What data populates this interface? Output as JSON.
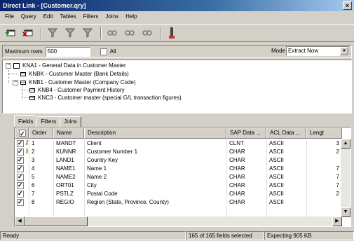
{
  "window": {
    "title": "Direct Link - [Customer.qry]",
    "close_glyph": "×"
  },
  "menu": [
    {
      "key": "F",
      "rest": "ile"
    },
    {
      "key": "Q",
      "rest": "uery"
    },
    {
      "key": "E",
      "rest": "dit"
    },
    {
      "key": "T",
      "rest": "ables"
    },
    {
      "key": "",
      "rest": "Filters",
      "u": "i"
    },
    {
      "key": "J",
      "rest": "oins"
    },
    {
      "key": "H",
      "rest": "elp"
    }
  ],
  "menu_labels": [
    "File",
    "Query",
    "Edit",
    "Tables",
    "Filters",
    "Joins",
    "Help"
  ],
  "toolbar": {
    "icons": [
      "add-table-icon",
      "remove-table-icon",
      "filter-add-icon",
      "filter-edit-icon",
      "filter-remove-icon",
      "join-add-icon",
      "join-edit-icon",
      "join-remove-icon",
      "run-icon"
    ]
  },
  "options": {
    "max_rows_label": "Maximum rows",
    "max_rows_value": "500",
    "all_label": "All",
    "all_checked": false,
    "mode_label": "Mode",
    "mode_value": "Extract Now"
  },
  "tree": {
    "root": "KNA1 - General Data in Customer Master",
    "children": [
      {
        "label": "KNBK - Customer Master (Bank Details)"
      },
      {
        "label": "KNB1 - Customer Master (Company Code)",
        "children": [
          "KNB4 - Customer Payment History",
          "KNC3 - Customer master (special G/L transaction figures)"
        ]
      }
    ]
  },
  "tabs": [
    {
      "label": "Fields",
      "active": true
    },
    {
      "label": "Filters",
      "active": false
    },
    {
      "label": "Joins",
      "active": false
    }
  ],
  "grid": {
    "columns": [
      "",
      "Order",
      "Name",
      "Description",
      "SAP Data ...",
      "ACL Data ...",
      "Lengt"
    ],
    "rows": [
      {
        "checked": true,
        "key": true,
        "order": "1",
        "name": "MANDT",
        "desc": "Client",
        "sap": "CLNT",
        "acl": "ASCII",
        "len": "3"
      },
      {
        "checked": true,
        "key": true,
        "order": "2",
        "name": "KUNNR",
        "desc": "Customer Number 1",
        "sap": "CHAR",
        "acl": "ASCII",
        "len": "2"
      },
      {
        "checked": true,
        "key": false,
        "order": "3",
        "name": "LAND1",
        "desc": "Country Key",
        "sap": "CHAR",
        "acl": "ASCII",
        "len": ""
      },
      {
        "checked": true,
        "key": false,
        "order": "4",
        "name": "NAME1",
        "desc": "Name 1",
        "sap": "CHAR",
        "acl": "ASCII",
        "len": "7"
      },
      {
        "checked": true,
        "key": false,
        "order": "5",
        "name": "NAME2",
        "desc": "Name 2",
        "sap": "CHAR",
        "acl": "ASCII",
        "len": "7"
      },
      {
        "checked": true,
        "key": false,
        "order": "6",
        "name": "ORT01",
        "desc": "City",
        "sap": "CHAR",
        "acl": "ASCII",
        "len": "7"
      },
      {
        "checked": true,
        "key": false,
        "order": "7",
        "name": "PSTLZ",
        "desc": "Postal Code",
        "sap": "CHAR",
        "acl": "ASCII",
        "len": "2"
      },
      {
        "checked": true,
        "key": false,
        "order": "8",
        "name": "REGIO",
        "desc": "Region (State, Province, County)",
        "sap": "CHAR",
        "acl": "ASCII",
        "len": ""
      }
    ]
  },
  "status": {
    "ready": "Ready",
    "selected": "165 of 165 fields selected",
    "expecting": "Expecting 905 KB"
  }
}
